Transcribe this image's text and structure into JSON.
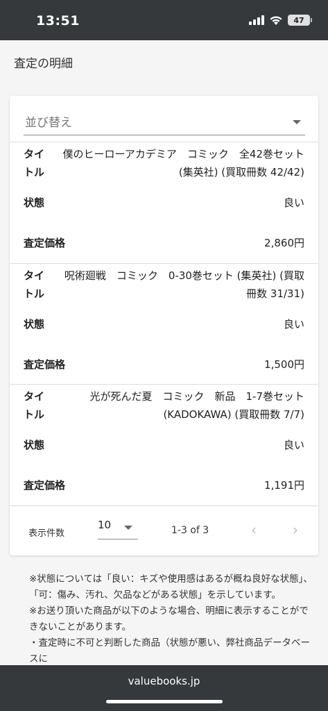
{
  "status_bar": {
    "time": "13:51",
    "battery": "47"
  },
  "page": {
    "title": "査定の明細"
  },
  "sort": {
    "label": "並び替え"
  },
  "labels": {
    "title": "タイトル",
    "condition": "状態",
    "price": "査定価格"
  },
  "items": [
    {
      "title": "僕のヒーローアカデミア　コミック　全42巻セット (集英社) (買取冊数 42/42)",
      "condition": "良い",
      "price": "2,860円"
    },
    {
      "title": "呪術廻戦　コミック　0-30巻セット (集英社) (買取冊数 31/31)",
      "condition": "良い",
      "price": "1,500円"
    },
    {
      "title": "光が死んだ夏　コミック　新品　1-7巻セット (KADOKAWA) (買取冊数 7/7)",
      "condition": "良い",
      "price": "1,191円"
    }
  ],
  "pagination": {
    "per_page_label": "表示件数",
    "per_page_value": "10",
    "range": "1-3 of 3"
  },
  "notes": [
    "※状態については「良い：キズや使用感はあるが概ね良好な状態」、「可：傷み、汚れ、欠品などがある状態」を示しています。",
    "※お送り頂いた商品が以下のような場合、明細に表示することができないことがあります。",
    "・査定時に不可と判断した商品（状態が悪い、弊社商品データベースに"
  ],
  "footer": {
    "url": "valuebooks.jp"
  }
}
